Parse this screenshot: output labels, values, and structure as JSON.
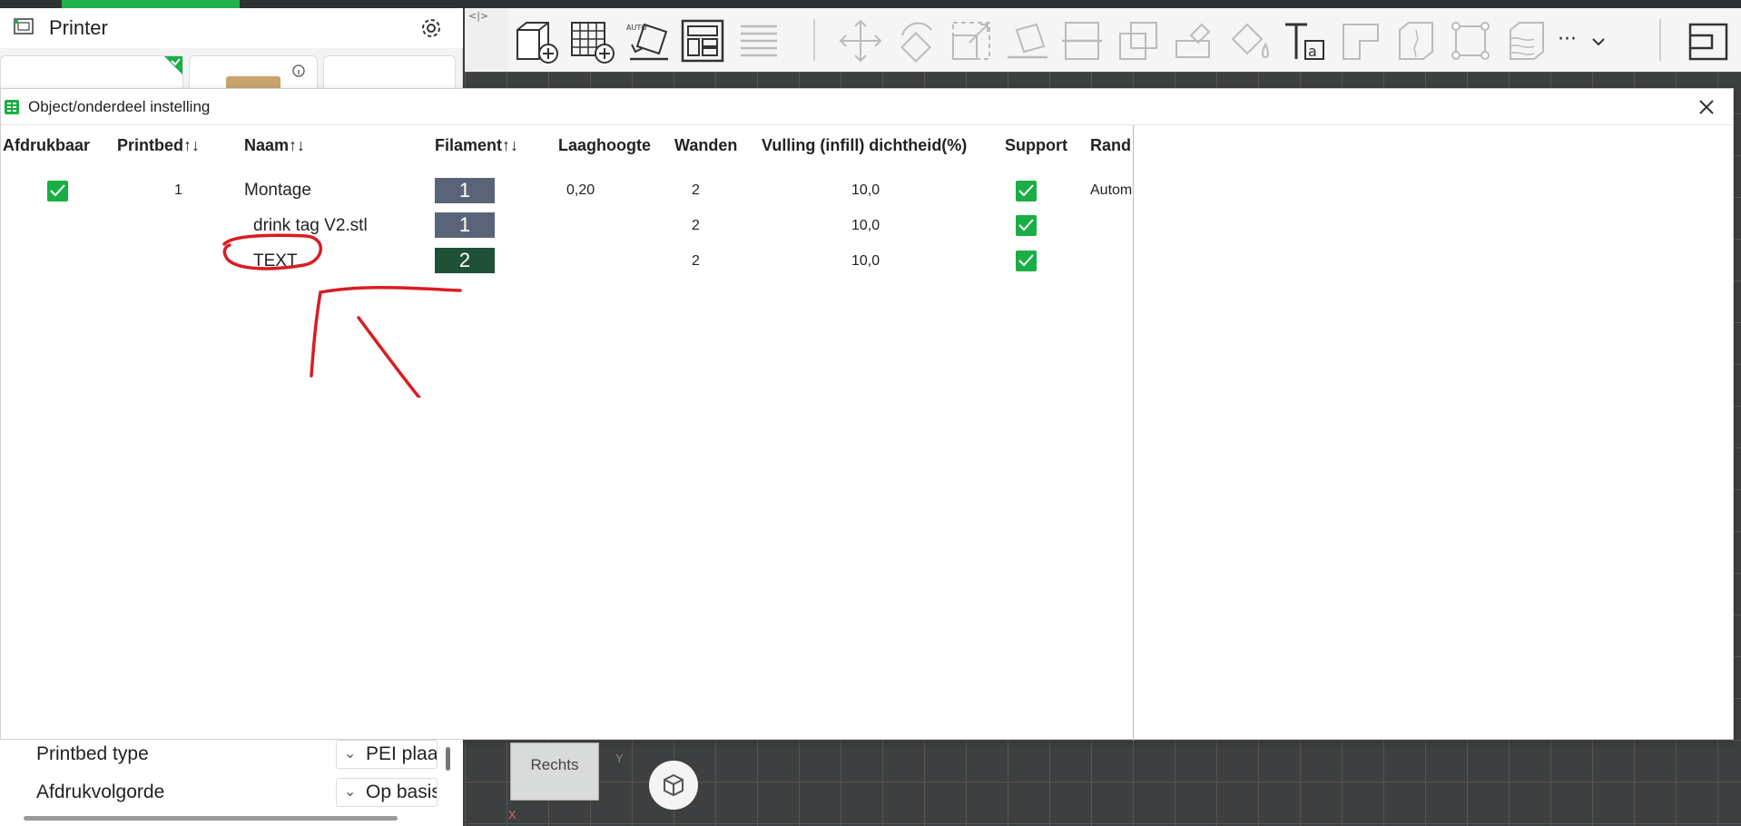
{
  "colors": {
    "accent": "#1aae46",
    "filament_1": "#5a6479",
    "filament_2": "#1f5136",
    "annotation": "#d91c24"
  },
  "printer_panel": {
    "title": "Printer"
  },
  "toolbar": {
    "icons": [
      "add-object-icon",
      "add-plate-icon",
      "auto-orient-icon",
      "arrange-icon",
      "layers-icon",
      "move-icon",
      "rotate-icon",
      "scale-icon",
      "lay-on-face-icon",
      "cut-icon",
      "split-icon",
      "support-paint-icon",
      "color-paint-icon",
      "text-icon",
      "chamfer-icon",
      "seam-icon",
      "measure-icon",
      "variable-layer-icon",
      "more-icon",
      "split-view-icon"
    ],
    "more_label": "···"
  },
  "dialog": {
    "title": "Object/onderdeel instelling",
    "columns": {
      "printable": "Afdrukbaar",
      "plate": "Printbed↑↓",
      "name": "Naam↑↓",
      "filament": "Filament↑↓",
      "layer_height": "Laaghoogte",
      "walls": "Wanden",
      "infill": "Vulling (infill) dichtheid(%)",
      "support": "Support",
      "brim": "Rand"
    },
    "rows": [
      {
        "printable": true,
        "plate": "1",
        "name": "Montage",
        "filament": "1",
        "layer_height": "0,20",
        "walls": "2",
        "infill": "10,0",
        "support": true,
        "brim": "Autom"
      },
      {
        "printable": null,
        "plate": "",
        "name": "drink tag V2.stl",
        "filament": "1",
        "layer_height": "",
        "walls": "2",
        "infill": "10,0",
        "support": true,
        "brim": ""
      },
      {
        "printable": null,
        "plate": "",
        "name": "TEXT",
        "filament": "2",
        "layer_height": "",
        "walls": "2",
        "infill": "10,0",
        "support": true,
        "brim": ""
      }
    ]
  },
  "settings": {
    "bed_type_label": "Printbed type",
    "bed_type_value": "PEI plaat",
    "print_order_label": "Afdrukvolgorde",
    "print_order_value": "Op basis"
  },
  "viewport": {
    "view_cube_label": "Rechts",
    "axis_y": "Y",
    "axis_x": "X"
  }
}
